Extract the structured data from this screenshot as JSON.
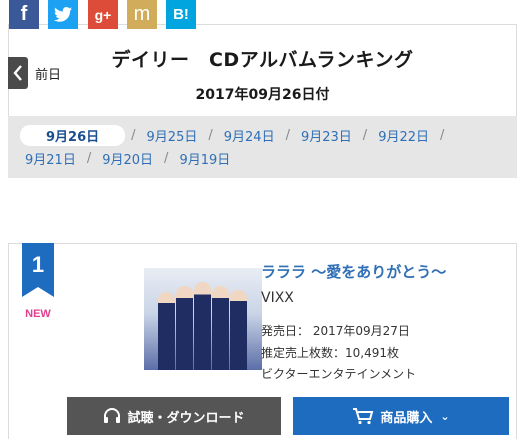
{
  "header": {
    "title": "デイリー　CDアルバムランキング",
    "subtitle": "2017年09月26日付",
    "prev_label": "前日"
  },
  "dates": {
    "row1": [
      "9月26日",
      "9月25日",
      "9月24日",
      "9月23日",
      "9月22日"
    ],
    "row2": [
      "9月21日",
      "9月20日",
      "9月19日"
    ],
    "active": "9月26日"
  },
  "social": {
    "facebook": "f",
    "twitter": "twitter-bird-icon",
    "googleplus": "g+",
    "mixi": "m",
    "hatena": "B!"
  },
  "ranking": {
    "rank": "1",
    "badge": "NEW",
    "title": "ラララ 〜愛をありがとう〜",
    "artist": "VIXX",
    "release_date": "発売日： 2017年09月27日",
    "sales": "推定売上枚数：10,491枚",
    "label": "ビクターエンタテインメント",
    "listen_button": "試聴・ダウンロード",
    "buy_button": "商品購入"
  },
  "colors": {
    "accent_blue": "#1e6cc0",
    "link_blue": "#2f6fb5",
    "new_pink": "#e0408f",
    "dark_button": "#555555"
  }
}
